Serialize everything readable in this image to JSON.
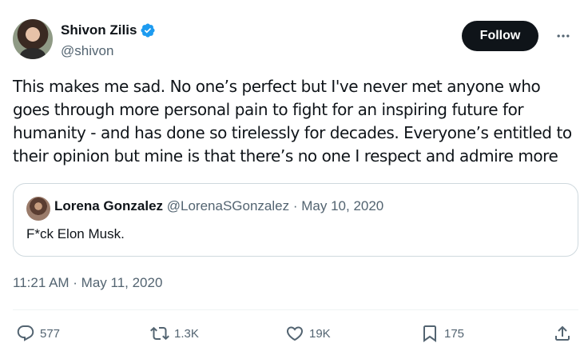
{
  "author": {
    "name": "Shivon Zilis",
    "handle": "@shivon",
    "verified": true
  },
  "header": {
    "follow_label": "Follow",
    "more_label": "···"
  },
  "tweet": {
    "text": "This makes me sad. No one’s perfect but I've never met anyone who goes through more personal pain to fight for an inspiring future for humanity - and has done so tirelessly for decades. Everyone’s entitled to their opinion but mine is that there’s no one I respect and admire more",
    "timestamp": "11:21 AM · May 11, 2020"
  },
  "quote": {
    "name": "Lorena Gonzalez",
    "handle": "@LorenaSGonzalez",
    "date": "· May 10, 2020",
    "text": "F*ck Elon Musk."
  },
  "actions": {
    "replies": "577",
    "reposts": "1.3K",
    "likes": "19K",
    "bookmarks": "175"
  },
  "colors": {
    "accent": "#1d9bf0",
    "text_primary": "#0f1419",
    "text_secondary": "#536471",
    "border": "#cfd9de"
  }
}
